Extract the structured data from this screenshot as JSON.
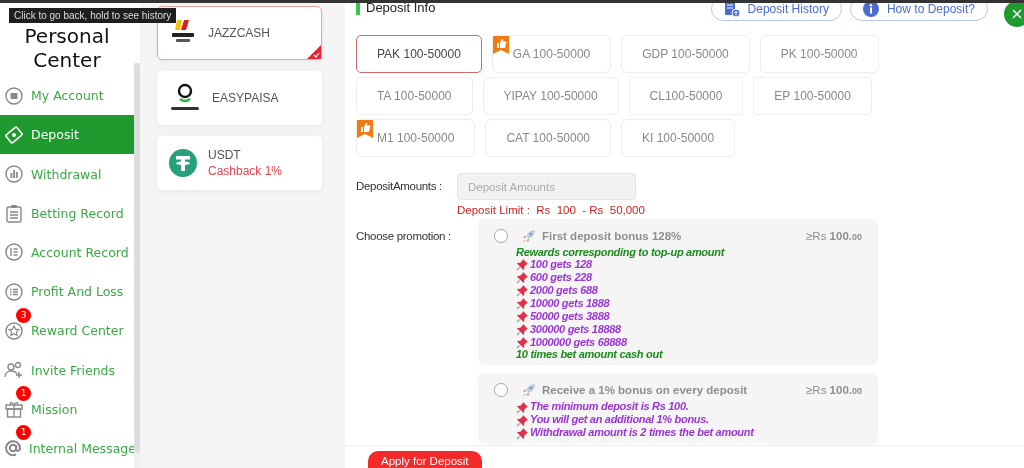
{
  "tooltip": "Click to go back, hold to see history",
  "sidebar": {
    "title": "Personal Center",
    "items": [
      {
        "label": "My Account",
        "selected": false
      },
      {
        "label": "Deposit",
        "selected": true
      },
      {
        "label": "Withdrawal",
        "selected": false
      },
      {
        "label": "Betting Record",
        "selected": false
      },
      {
        "label": "Account Record",
        "selected": false
      },
      {
        "label": "Profit And Loss",
        "selected": false
      },
      {
        "label": "Reward Center",
        "selected": false,
        "badge": "3"
      },
      {
        "label": "Invite Friends",
        "selected": false
      },
      {
        "label": "Mission",
        "selected": false,
        "badge": "1"
      },
      {
        "label": "Internal Message",
        "selected": false,
        "badge": "1"
      }
    ]
  },
  "methods": [
    {
      "name": "JAZZCASH",
      "selected": true
    },
    {
      "name": "EASYPAISA",
      "selected": false
    },
    {
      "name": "USDT",
      "selected": false,
      "note": "Cashback 1%"
    }
  ],
  "deposit_info": {
    "title": "Deposit Info",
    "buttons": [
      "Deposit History",
      "How to Deposit?"
    ],
    "channels": [
      {
        "label": "PAK 100-50000",
        "selected": true,
        "hot": false
      },
      {
        "label": "GA 100-50000",
        "selected": false,
        "hot": true
      },
      {
        "label": "GDP 100-50000",
        "selected": false,
        "hot": false
      },
      {
        "label": "PK 100-50000",
        "selected": false,
        "hot": false
      },
      {
        "label": "TA 100-50000",
        "selected": false,
        "hot": false
      },
      {
        "label": "YIPAY 100-50000",
        "selected": false,
        "hot": false
      },
      {
        "label": "CL100-50000",
        "selected": false,
        "hot": false
      },
      {
        "label": "EP 100-50000",
        "selected": false,
        "hot": false
      },
      {
        "label": "M1 100-50000",
        "selected": false,
        "hot": true
      },
      {
        "label": "CAT 100-50000",
        "selected": false,
        "hot": false
      },
      {
        "label": "KI 100-50000",
        "selected": false,
        "hot": false
      }
    ],
    "amount_label": "DepositAmounts :",
    "amount_placeholder": "Deposit Amounts",
    "limit": "Deposit Limit :  Rs  100  - Rs  50,000",
    "promotion_label": "Choose promotion :",
    "promotions": [
      {
        "title": "First deposit bonus 128%",
        "selected": false,
        "minimum": "≥Rs",
        "amount": "100.",
        "cents": "00",
        "lines": [
          {
            "kind": "heading",
            "text": "Rewards corresponding to top-up amount"
          },
          {
            "kind": "pin",
            "text": "100 gets 128"
          },
          {
            "kind": "pin",
            "text": "600 gets 228"
          },
          {
            "kind": "pin",
            "text": "2000 gets 688"
          },
          {
            "kind": "pin",
            "text": "10000 gets 1888"
          },
          {
            "kind": "pin",
            "text": "50000 gets 3888"
          },
          {
            "kind": "pin",
            "text": "300000 gets 18888"
          },
          {
            "kind": "pin",
            "text": "1000000 gets 68888"
          },
          {
            "kind": "heading",
            "text": "10 times bet amount cash out"
          }
        ]
      },
      {
        "title": "Receive a 1% bonus on every deposit",
        "selected": false,
        "minimum": "≥Rs",
        "amount": "100.",
        "cents": "00",
        "lines": [
          {
            "kind": "pin",
            "text": "The minimum deposit is Rs 100."
          },
          {
            "kind": "pin",
            "text": "You will get an additional 1% bonus."
          },
          {
            "kind": "pin",
            "text": "Withdrawal amount is 2 times the bet amount"
          }
        ]
      }
    ],
    "submit": "Apply for Deposit"
  }
}
